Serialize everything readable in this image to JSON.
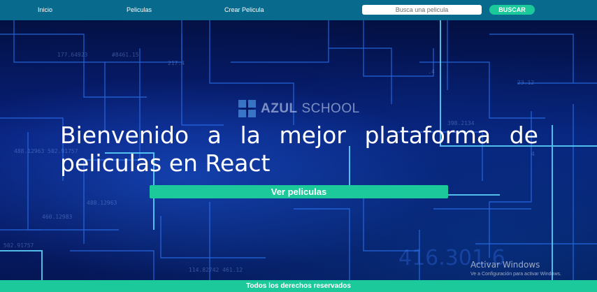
{
  "nav": {
    "links": [
      "Inicio",
      "Peliculas",
      "Crear Pelicula"
    ],
    "search_placeholder": "Busca una pelicula",
    "search_button": "BUSCAR"
  },
  "hero": {
    "logo_bold": "AZUL",
    "logo_rest": "SCHOOL",
    "title": "Bienvenido a la mejor plataforma de peliculas en React",
    "cta_button": "Ver peliculas"
  },
  "watermark": {
    "title": "Activar Windows",
    "subtitle": "Ve a Configuración para activar Windows."
  },
  "footer": {
    "text": "Todos los derechos reservados"
  },
  "colors": {
    "navbar": "#086a8c",
    "accent": "#1cc99b",
    "background": "#020a2a"
  }
}
